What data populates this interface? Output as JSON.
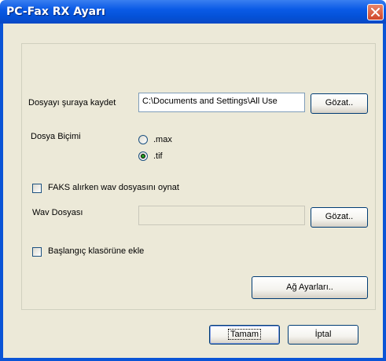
{
  "window": {
    "title": "PC-Fax RX Ayarı",
    "close_icon": "close-icon",
    "titlebar_color": "#0a5ae6",
    "client_color": "#ece9d8"
  },
  "save_location": {
    "label": "Dosyayı şuraya kaydet",
    "value": "C:\\Documents and Settings\\All Use",
    "browse_label": "Gözat.."
  },
  "file_format": {
    "label": "Dosya Biçimi",
    "options": [
      {
        "label": ".max",
        "selected": false
      },
      {
        "label": ".tif",
        "selected": true
      }
    ]
  },
  "play_wav": {
    "label": "FAKS alırken wav dosyasını oynat",
    "checked": false
  },
  "wav_file": {
    "label": "Wav Dosyası",
    "value": "",
    "browse_label": "Gözat.."
  },
  "startup": {
    "label": "Başlangıç klasörüne ekle",
    "checked": false
  },
  "buttons": {
    "network_settings": "Ağ Ayarları..",
    "ok": "Tamam",
    "cancel": "İptal"
  }
}
